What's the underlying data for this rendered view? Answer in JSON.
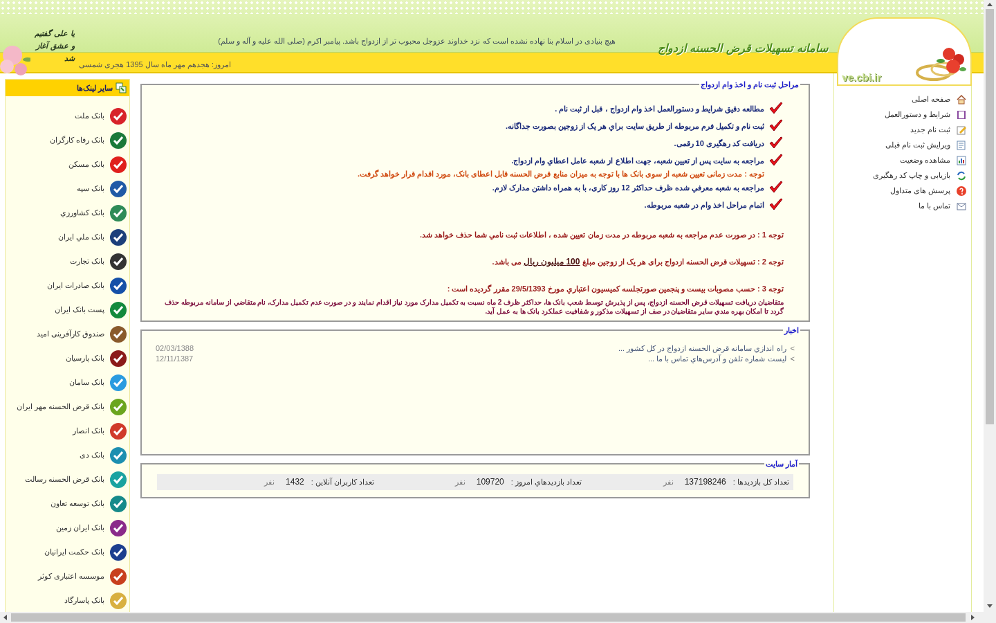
{
  "header": {
    "site_title": "سامانه تسهیلات قرض الحسنه ازدواج",
    "hadith": "هیچ بنیادی در اسلام بنا نهاده نشده است که نزد خداوند عزوجل محبوب تر از ازدواج باشد. پیامبر اکرم (صلی الله علیه و آله و سلم)",
    "date": "امروز: هجدهم مهر ماه سال 1395 هجری شمسی",
    "logo_text": "ve.cbi.ir",
    "motto": "یا علی گفتیم و عشق آغاز شد"
  },
  "menu": [
    {
      "label": "صفحه اصلی"
    },
    {
      "label": "شرایط و دستورالعمل"
    },
    {
      "label": "ثبت نام جدید"
    },
    {
      "label": "ویرایش ثبت نام قبلی"
    },
    {
      "label": "مشاهده وضعیت"
    },
    {
      "label": "بازیابی و چاپ کد رهگیری"
    },
    {
      "label": "پرسش های متداول"
    },
    {
      "label": "تماس با ما"
    }
  ],
  "links": {
    "title": "سایر لینک‌ها",
    "items": [
      {
        "label": "بانک ملت",
        "color": "#d8232a"
      },
      {
        "label": "بانک رفاه کارگران",
        "color": "#1a7a3a"
      },
      {
        "label": "بانک مسکن",
        "color": "#e0201c"
      },
      {
        "label": "بانک سپه",
        "color": "#1f5aa6"
      },
      {
        "label": "بانک کشاورزي",
        "color": "#2e8b57"
      },
      {
        "label": "بانک ملي ايران",
        "color": "#1c3f7a"
      },
      {
        "label": "بانک تجارت",
        "color": "#333333"
      },
      {
        "label": "بانک صادرات ايران",
        "color": "#1550a8"
      },
      {
        "label": "پست بانک ايران",
        "color": "#138a3c"
      },
      {
        "label": "صندوق کارآفرینی امید",
        "color": "#8a5a2b"
      },
      {
        "label": "بانک پارسيان",
        "color": "#8b1a1a"
      },
      {
        "label": "بانک سامان",
        "color": "#2a9be0"
      },
      {
        "label": "بانک قرض الحسنه مهر ايران",
        "color": "#6aa51e"
      },
      {
        "label": "بانک انصار",
        "color": "#d03a2a"
      },
      {
        "label": "بانک دی",
        "color": "#1c8fb0"
      },
      {
        "label": "بانک قرض الحسنه رسالت",
        "color": "#1aa3a0"
      },
      {
        "label": "بانک توسعه تعاون",
        "color": "#168a8a"
      },
      {
        "label": "بانک ایران زمین",
        "color": "#8a2a8a"
      },
      {
        "label": "بانک حکمت ايرانيان",
        "color": "#1d3f8f"
      },
      {
        "label": "موسسه اعتباری کوثر",
        "color": "#c8401e"
      },
      {
        "label": "بانک پاسارگاد",
        "color": "#d8b040"
      }
    ]
  },
  "steps": {
    "title": "مراحل ثبت نام و اخذ وام ازدواج",
    "items": [
      {
        "kind": "step",
        "text": "مطالعه دقيق شرايط و دستورالعمل اخذ وام ازدواج ، قبل از ثبت نام ."
      },
      {
        "kind": "step",
        "text": "ثبت نام و تکميل فرم مربوطه از طريق سايت براي هر يک از زوجين بصورت جداگانه."
      },
      {
        "kind": "step",
        "text": "دريافت کد رهگيری 10 رقمی."
      },
      {
        "kind": "step",
        "text": "مراجعه به سايت پس از تعيين شعبه، جهت اطلاع از شعبه عامل اعطاي وام ازدواج."
      },
      {
        "kind": "note",
        "text": "توجه : مدت زمانی تعيين شعبه از سوی بانک ها با توجه به ميزان منابع قرض الحسنه قابل اعطای بانک، مورد اقدام قرار خواهد گرفت."
      },
      {
        "kind": "step",
        "text": "مراجعه به شعبه معرفي شده ظرف حداکثر 12 روز کاری، با به همراه داشتن مدارک لازم."
      },
      {
        "kind": "step",
        "text": "اتمام مراحل اخذ وام در شعبه مربوطه."
      }
    ],
    "notes": [
      {
        "text": "توجه 1 :  در صورت عدم مراجعه به شعبه مربوطه در مدت زمان تعيين شده ، اطلاعات ثبت نامي شما حذف خواهد شد."
      },
      {
        "text": "توجه 2 :  تسهیلات قرض الحسنه ازدواج برای هر یک از زوجین مبلغ **100 میلیون ریال** می باشد."
      },
      {
        "text": "توجه 3 : حسب مصوبات بيست و پنجمين صورتجلسه کميسيون اعتباري مورخ 29/5/1393 مقرر گرديده است :",
        "body": "متقاضيان دريافت تسهيلات قرض الحسنه ازدواج، پس از پذيرش توسط شعب بانک ها، حداکثر ظرف 2 ماه نسبت به تکميل مدارک مورد نياز اقدام نمايند و در صورت عدم تکميل مدارک، نام متقاضي از سامانه مربوطه حذف گردد تا امکان بهره مندي ساير متقاضيان در صف از تسهيلات مذکور و شفافيت عملکرد بانک ها به عمل آيد."
      }
    ]
  },
  "news": {
    "title": "اخبار",
    "items": [
      {
        "text": "راه اندازي سامانه قرض الحسنه ازدواج در کل کشور ...",
        "date": "02/03/1388"
      },
      {
        "text": "ليست شماره تلفن و آدرس‌هاي تماس با ما ...",
        "date": "12/11/1387"
      }
    ],
    "bullet": ">"
  },
  "stats": {
    "title": "آمار سايت",
    "items": [
      {
        "label": "تعداد کل بازديدها :",
        "value": "137198246",
        "unit": "نفر"
      },
      {
        "label": "تعداد بازديدهاي امروز :",
        "value": "109720",
        "unit": "نفر"
      },
      {
        "label": "تعداد کاربران آنلاين :",
        "value": "1432",
        "unit": "نفر"
      }
    ]
  }
}
